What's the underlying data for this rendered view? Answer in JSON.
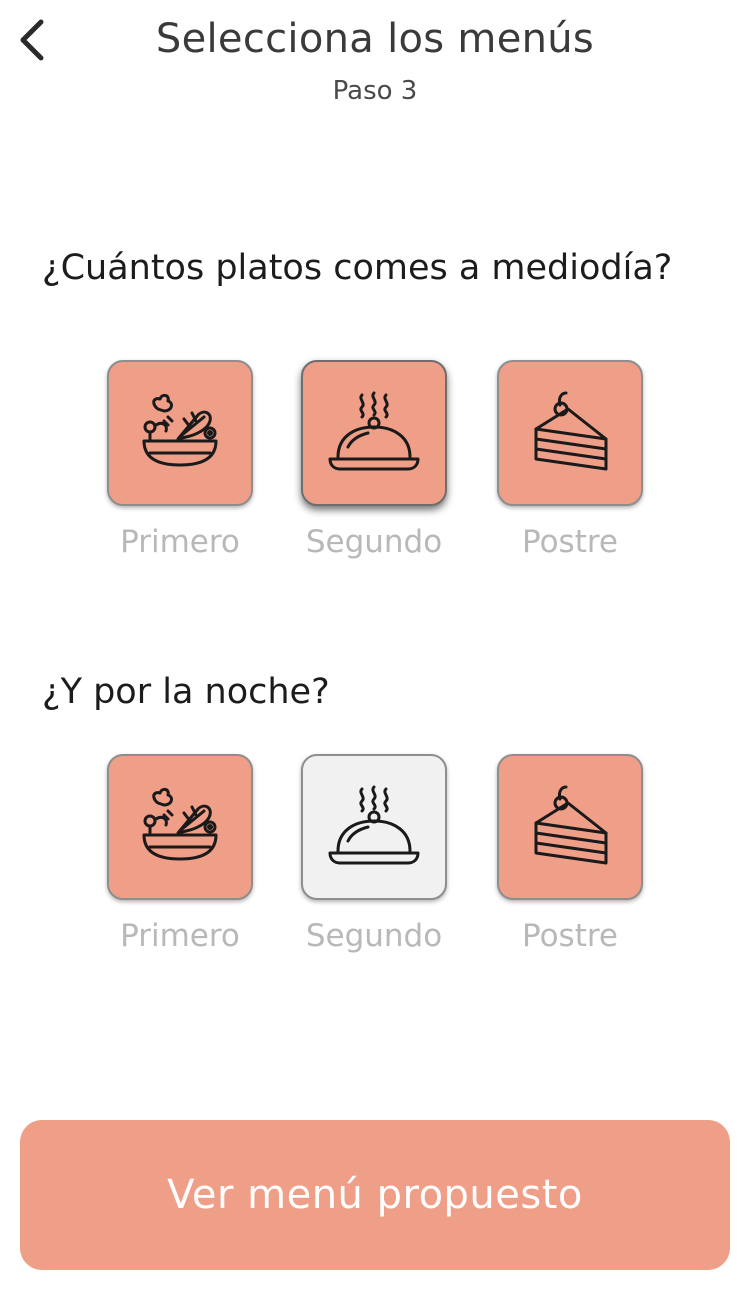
{
  "header": {
    "back_icon": "chevron-left-icon",
    "title": "Selecciona los menús",
    "subtitle": "Paso 3"
  },
  "lunch": {
    "question": "¿Cuántos platos comes a mediodía?",
    "options": [
      {
        "label": "Primero",
        "icon": "salad-bowl-icon",
        "selected": true
      },
      {
        "label": "Segundo",
        "icon": "cloche-icon",
        "selected": true
      },
      {
        "label": "Postre",
        "icon": "cake-slice-icon",
        "selected": true
      }
    ]
  },
  "dinner": {
    "question": "¿Y por la noche?",
    "options": [
      {
        "label": "Primero",
        "icon": "salad-bowl-icon",
        "selected": true
      },
      {
        "label": "Segundo",
        "icon": "cloche-icon",
        "selected": false
      },
      {
        "label": "Postre",
        "icon": "cake-slice-icon",
        "selected": true
      }
    ]
  },
  "cta": {
    "label": "Ver menú propuesto"
  },
  "colors": {
    "accent": "#ef9e87",
    "tile_off": "#f2f1f2",
    "label_muted": "#b8b8b8"
  }
}
